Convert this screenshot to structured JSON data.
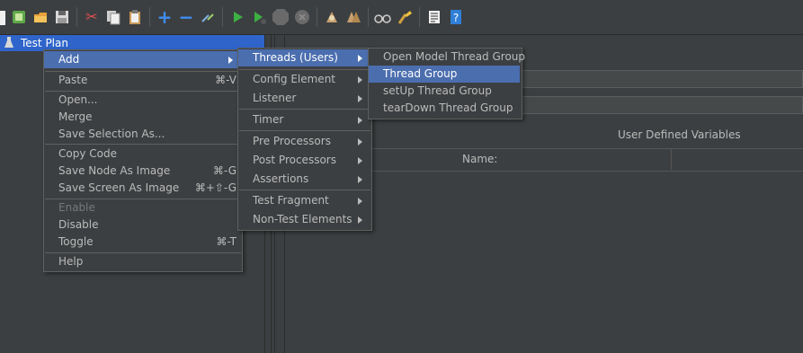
{
  "toolbar": {
    "icons": [
      "new-icon",
      "templates-icon",
      "open-icon",
      "save-icon",
      "cut-icon",
      "copy-icon",
      "paste-icon",
      "expand-icon",
      "collapse-icon",
      "toggle-icon",
      "start-icon",
      "start-no-pauses-icon",
      "stop-icon",
      "shutdown-icon",
      "clear-icon",
      "clear-all-icon",
      "search-icon",
      "reset-search-icon",
      "function-helper-icon",
      "help-icon"
    ]
  },
  "tree": {
    "root_label": "Test Plan"
  },
  "right_panel": {
    "udv_label": "User Defined Variables",
    "name_column": "Name:"
  },
  "context_menu": {
    "add": "Add",
    "paste": "Paste",
    "paste_shortcut": "⌘-V",
    "open": "Open...",
    "merge": "Merge",
    "save_selection": "Save Selection As...",
    "copy_code": "Copy Code",
    "save_node_image": "Save Node As Image",
    "save_node_image_shortcut": "⌘-G",
    "save_screen_image": "Save Screen As Image",
    "save_screen_image_shortcut": "⌘+⇧-G",
    "enable": "Enable",
    "disable": "Disable",
    "toggle": "Toggle",
    "toggle_shortcut": "⌘-T",
    "help": "Help"
  },
  "add_submenu": {
    "threads": "Threads (Users)",
    "config_element": "Config Element",
    "listener": "Listener",
    "timer": "Timer",
    "pre_processors": "Pre Processors",
    "post_processors": "Post Processors",
    "assertions": "Assertions",
    "test_fragment": "Test Fragment",
    "non_test_elements": "Non-Test Elements"
  },
  "threads_submenu": {
    "open_model": "Open Model Thread Group",
    "thread_group": "Thread Group",
    "setup": "setUp Thread Group",
    "teardown": "tearDown Thread Group"
  },
  "colors": {
    "background": "#3c3f41",
    "selection": "#4b6eaf",
    "tree_selection": "#2f65ca",
    "text": "#bbbbbb",
    "disabled_text": "#777777"
  }
}
